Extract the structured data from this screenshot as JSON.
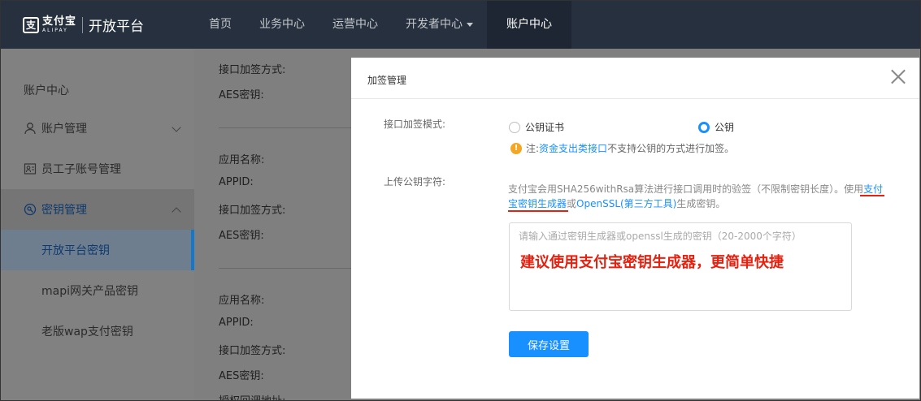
{
  "header": {
    "logo_mark": "支",
    "logo_brand": "支付宝",
    "logo_sub": "ALIPAY",
    "platform": "开放平台",
    "nav": [
      {
        "label": "首页"
      },
      {
        "label": "业务中心"
      },
      {
        "label": "运营中心"
      },
      {
        "label": "开发者中心"
      },
      {
        "label": "账户中心"
      }
    ]
  },
  "sidebar": {
    "title": "账户中心",
    "items": [
      {
        "label": "账户管理"
      },
      {
        "label": "员工子账号管理"
      },
      {
        "label": "密钥管理"
      }
    ],
    "sub_items": [
      {
        "label": "开放平台密钥"
      },
      {
        "label": "mapi网关产品密钥"
      },
      {
        "label": "老版wap支付密钥"
      }
    ]
  },
  "background": {
    "lines": [
      "接口加签方式:",
      "AES密钥:",
      "应用名称:",
      "APPID:",
      "接口加签方式:",
      "AES密钥:",
      "应用名称:",
      "APPID:",
      "接口加签方式:",
      "AES密钥:",
      "授权回调地址:"
    ]
  },
  "modal": {
    "title": "加签管理",
    "mode_label": "接口加签模式:",
    "radio_cert": "公钥证书",
    "radio_key": "公钥",
    "note_prefix": "注:",
    "note_link": "资金支出类接口",
    "note_suffix": "不支持公钥的方式进行加签。",
    "upload_label": "上传公钥字符:",
    "desc_part1": "支付宝会用SHA256withRsa算法进行接口调用时的验签（不限制密钥长度）。使用",
    "desc_link1": "支付宝密钥生成器",
    "desc_or": "或",
    "desc_link2": "OpenSSL(第三方工具)",
    "desc_part2": "生成密钥。",
    "textarea_placeholder": "请输入通过密钥生成器或openssl生成的密钥（20-2000个字符）",
    "callout": "建议使用支付宝密钥生成器，更简单快捷",
    "save_label": "保存设置"
  },
  "colors": {
    "topbar": "#26303f",
    "accent": "#1890ff",
    "annotation_red": "#e6210f",
    "warning": "#f5a623"
  }
}
